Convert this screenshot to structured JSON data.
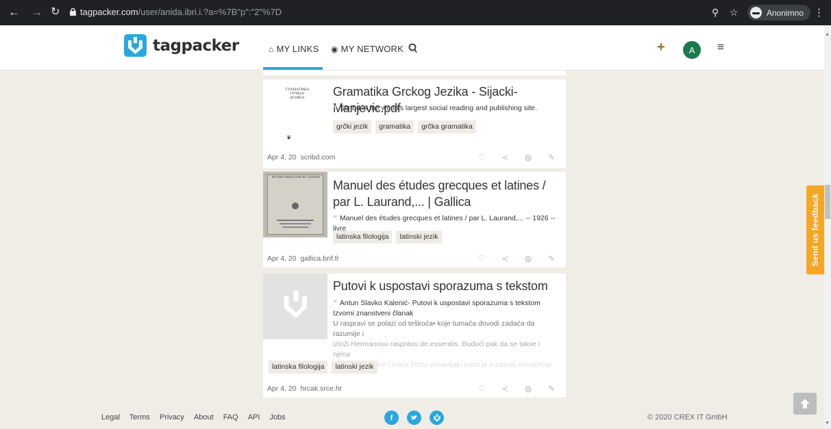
{
  "browser": {
    "url_host": "tagpacker.com",
    "url_path": "/user/anida.ibri.i.?a=%7B\"p\":\"2\"%7D",
    "profile_label": "Anonimno"
  },
  "header": {
    "logo_text": "tagpacker",
    "nav": [
      {
        "label": "MY LINKS"
      },
      {
        "label": "MY NETWORK"
      }
    ],
    "avatar_initial": "A"
  },
  "cards": [
    {
      "title": "Gramatika Grckog Jezika - Sijacki-Manjevic.pdf",
      "thumb_text_1": "ГРАМАТИКА",
      "thumb_text_2": "ГРЧКОГ ЈЕЗИКА",
      "description": "Scribd is the world's largest social reading and publishing site.",
      "tags": [
        "grčki jezik",
        "gramatika",
        "grčka gramatika"
      ],
      "date": "Apr 4, 20",
      "domain": "scribd.com"
    },
    {
      "title": "Manuel des études grecques et latines / par L. Laurand,... | Gallica",
      "thumb_text_1": "ÉTUDES GRECQUES ET LATINES",
      "description": "Manuel des études grecques et latines / par L. Laurand,... -- 1926 -- livre",
      "tags": [
        "latinska filologija",
        "latinski jezik"
      ],
      "date": "Apr 4, 20",
      "domain": "gallica.bnf.fr"
    },
    {
      "title": "Putovi k uspostavi sporazuma s tekstom",
      "description_lines": [
        "Antun Slavko Kalenić- Putovi k uspostavi sporazuma s tekstom",
        "Izvorni znanstveni članak",
        "U raspravi se polazi od teškoća• koje tumača dovodi zadaća da razumije i",
        "izloži Hermanovu raspravu de essentiis. Budući pak da se takve i njima",
        "slične poteškoće i inače često posavljaju kada je u pitanju tumačenje"
      ],
      "tags": [
        "latinska filologija",
        "latinski jezik"
      ],
      "date": "Apr 4, 20",
      "domain": "hrcak.srce.hr"
    }
  ],
  "footer": {
    "links": [
      "Legal",
      "Terms",
      "Privacy",
      "About",
      "FAQ",
      "API",
      "Jobs"
    ],
    "social": [
      "f",
      "t",
      "tp"
    ],
    "copyright": "© 2020 CREX IT GmbH"
  },
  "feedback_label": "Send us feedback",
  "icons": {
    "back": "arrow-left-icon",
    "forward": "arrow-right-icon",
    "reload": "reload-icon",
    "heart": "heart-icon",
    "share": "share-icon",
    "globe": "globe-icon",
    "edit": "pencil-icon"
  },
  "colors": {
    "accent": "#2aa8de",
    "page_bg": "#efede6",
    "feedback": "#f5a623",
    "avatar": "#1a7a4c"
  }
}
